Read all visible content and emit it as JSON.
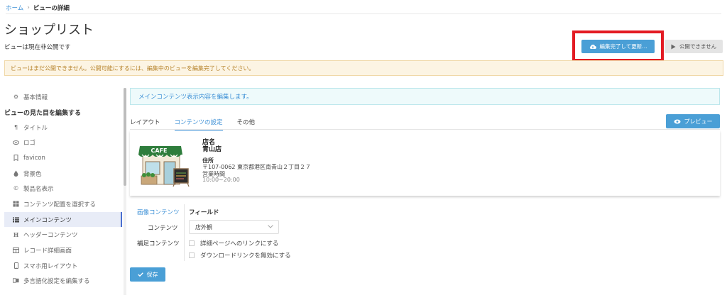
{
  "breadcrumb": {
    "home": "ホーム",
    "separator": "›",
    "current": "ビューの詳細"
  },
  "page": {
    "title": "ショップリスト",
    "status": "ビューは現在非公開です"
  },
  "buttons": {
    "update": "編集完了して更新...",
    "unpublish": "公開できません",
    "preview": "プレビュー",
    "save": "保存"
  },
  "warning": "ビューはまだ公開できません。公開可能にするには、編集中のビューを編集完了してください。",
  "info": "メインコンテンツ表示内容を編集します。",
  "sidebar": {
    "heading": "ビューの見た目を編集する",
    "items": [
      {
        "label": "基本情報",
        "icon": "gear-icon"
      },
      {
        "label": "タイトル",
        "icon": "paragraph-icon"
      },
      {
        "label": "ロゴ",
        "icon": "eye-icon"
      },
      {
        "label": "favicon",
        "icon": "bookmark-icon"
      },
      {
        "label": "背景色",
        "icon": "droplet-icon"
      },
      {
        "label": "製品名表示",
        "icon": "copyright-icon"
      },
      {
        "label": "コンテンツ配置を選択する",
        "icon": "grid-icon"
      },
      {
        "label": "メインコンテンツ",
        "icon": "list-icon"
      },
      {
        "label": "ヘッダーコンテンツ",
        "icon": "heading-icon"
      },
      {
        "label": "レコード詳細画面",
        "icon": "window-icon"
      },
      {
        "label": "スマホ用レイアウト",
        "icon": "mobile-icon"
      },
      {
        "label": "多言語化設定を編集する",
        "icon": "language-icon"
      }
    ]
  },
  "tabs": [
    {
      "label": "レイアウト",
      "active": false
    },
    {
      "label": "コンテンツの設定",
      "active": true
    },
    {
      "label": "その他",
      "active": false
    }
  ],
  "card": {
    "title": "店名",
    "name": "青山店",
    "address_label": "住所",
    "address": "〒107-0062 東京都港区南青山２丁目２７",
    "hours_label": "営業時間",
    "hours": "10:00~20:00",
    "image_text": "CAFE"
  },
  "form": {
    "label_image": "画像コンテンツ",
    "label_content": "コンテンツ",
    "label_supplement": "補足コンテンツ",
    "field_heading": "フィールド",
    "select_value": "店外観",
    "check1": "詳細ページへのリンクにする",
    "check2": "ダウンロードリンクを無効にする"
  },
  "colors": {
    "primary": "#4a9fd6",
    "highlight": "#e31b23",
    "warning_bg": "#fcf4e3",
    "info_bg": "#eefafb"
  }
}
